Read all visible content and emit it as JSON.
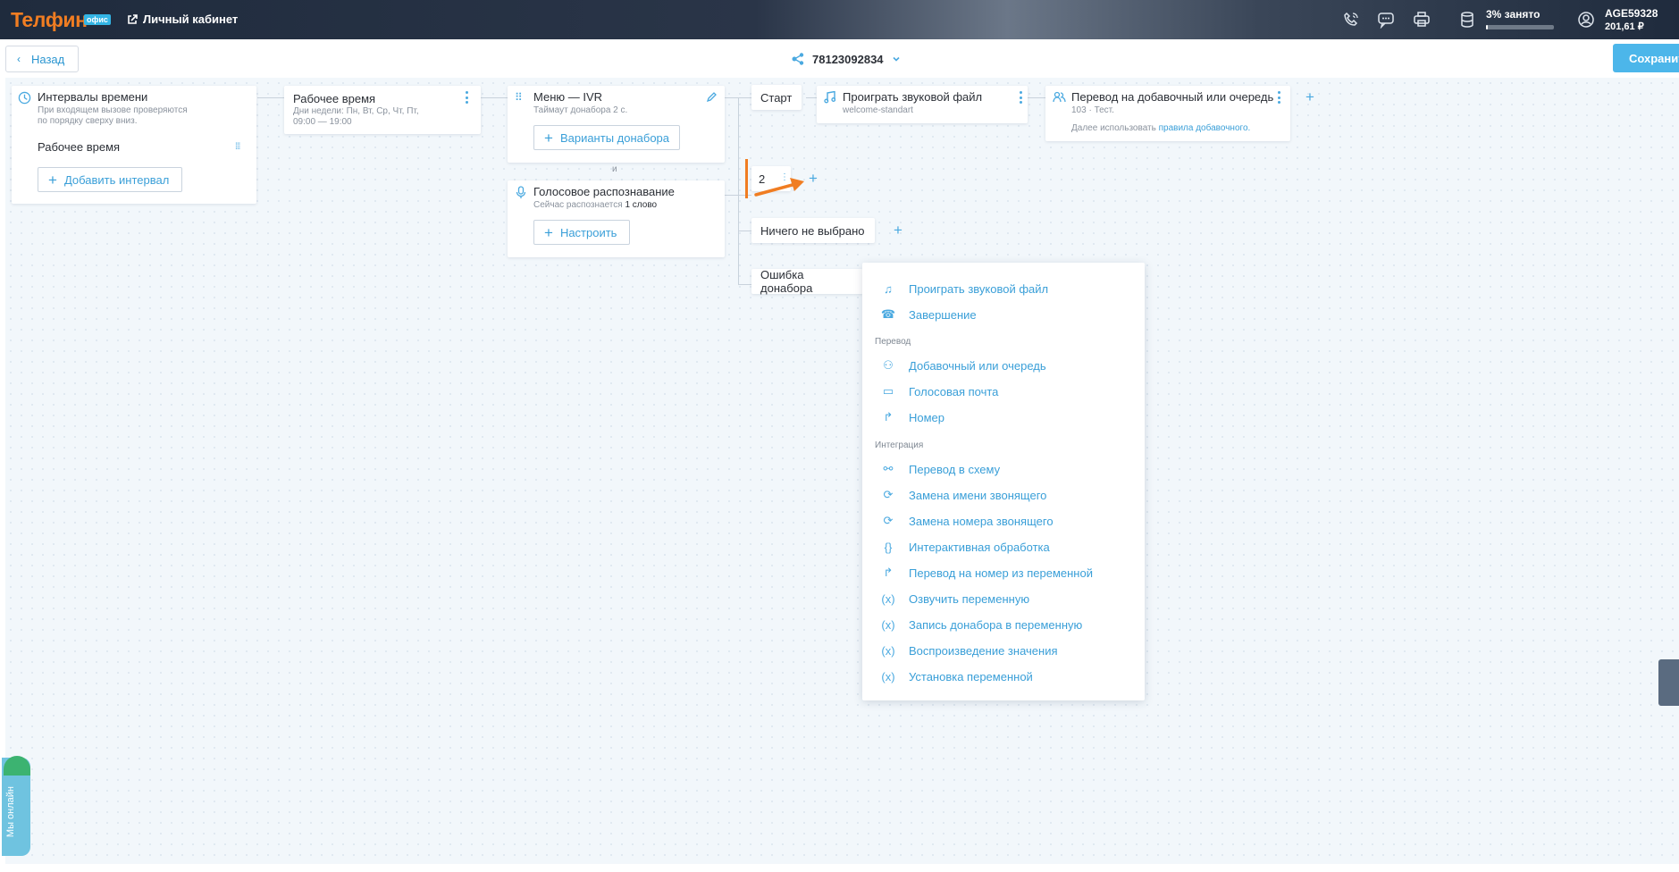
{
  "header": {
    "logo": "Телфин",
    "logo_badge": "офис",
    "cabinet_label": "Личный кабинет",
    "storage_label": "3% занято",
    "storage_fraction": 0.03,
    "account_id": "AGE59328",
    "balance": "201,61 ₽",
    "icons": [
      "phone-icon",
      "chat-icon",
      "printer-icon",
      "database-icon",
      "user-icon"
    ]
  },
  "subbar": {
    "back_label": "Назад",
    "scheme_number": "78123092834",
    "save_label": "Сохранить"
  },
  "nodes": {
    "intervals": {
      "title": "Интервалы времени",
      "sub1": "При входящем вызове проверяются",
      "sub2": "по порядку сверху вниз.",
      "item": "Рабочее время",
      "add_label": "Добавить интервал"
    },
    "worktime": {
      "title": "Рабочее время",
      "sub1": "Дни недели: Пн, Вт, Ср, Чт, Пт,",
      "sub2": "09:00 — 19:00"
    },
    "ivr": {
      "title": "Меню — IVR",
      "sub": "Таймаут донабора 2 с.",
      "button": "Варианты донабора",
      "and": "и"
    },
    "voice": {
      "title": "Голосовое распознавание",
      "sub_prefix": "Сейчас распознается",
      "sub_value": "1 слово",
      "button": "Настроить"
    },
    "start": "Старт",
    "play": {
      "title": "Проиграть звуковой файл",
      "sub": "welcome-standart"
    },
    "transfer": {
      "title": "Перевод на добавочный или очередь",
      "sub": "103 · Тест.",
      "note_prefix": "Далее использовать",
      "note_link": "правила добавочного."
    },
    "option_digit": "2",
    "nothing_selected": "Ничего не выбрано",
    "dial_error": "Ошибка донабора"
  },
  "menu": {
    "top_items": [
      {
        "label": "Проиграть звуковой файл",
        "icon": "music-note-icon"
      },
      {
        "label": "Завершение",
        "icon": "hangup-icon"
      }
    ],
    "section_transfer": "Перевод",
    "transfer_items": [
      {
        "label": "Добавочный или очередь",
        "icon": "queue-icon"
      },
      {
        "label": "Голосовая почта",
        "icon": "voicemail-icon"
      },
      {
        "label": "Номер",
        "icon": "forward-arrow-icon"
      }
    ],
    "section_integration": "Интеграция",
    "integration_items": [
      {
        "label": "Перевод в схему",
        "icon": "scheme-icon"
      },
      {
        "label": "Замена имени звонящего",
        "icon": "swap-icon"
      },
      {
        "label": "Замена номера звонящего",
        "icon": "swap-icon"
      },
      {
        "label": "Интерактивная обработка",
        "icon": "braces-icon"
      },
      {
        "label": "Перевод на номер из переменной",
        "icon": "forward-arrow-icon"
      },
      {
        "label": "Озвучить переменную",
        "icon": "variable-icon"
      },
      {
        "label": "Запись донабора в переменную",
        "icon": "variable-icon"
      },
      {
        "label": "Воспроизведение значения",
        "icon": "variable-icon"
      },
      {
        "label": "Установка переменной",
        "icon": "variable-icon"
      }
    ]
  },
  "online_widget": "Мы онлайн",
  "colors": {
    "accent": "#4aa9e0",
    "brand_orange": "#f07d22",
    "annotation_arrow": "#f07d22"
  }
}
